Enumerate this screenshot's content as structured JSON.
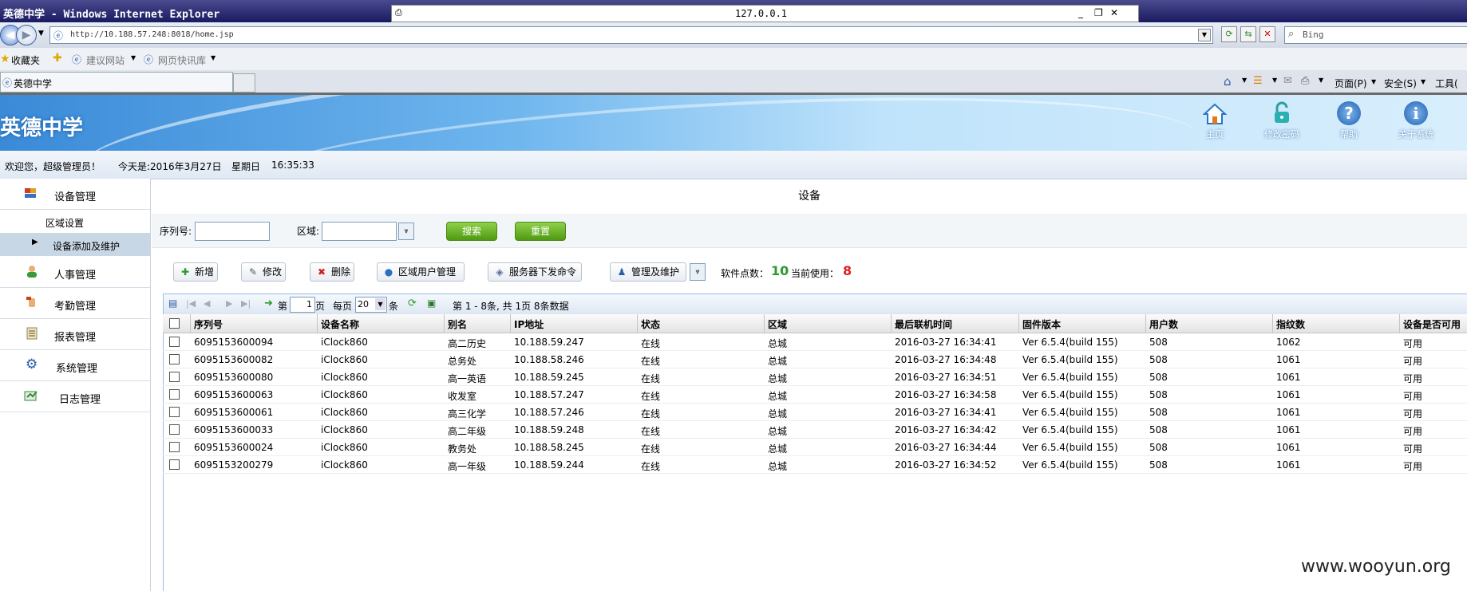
{
  "browser": {
    "window_title": "英德中学 - Windows Internet Explorer",
    "popup_address": "127.0.0.1",
    "url": "http://10.188.57.248:8018/home.jsp",
    "search_placeholder": "Bing",
    "favorites_label": "收藏夹",
    "fav_items": [
      "建议网站",
      "网页快讯库"
    ],
    "tab_title": "英德中学",
    "commands": [
      "页面(P)",
      "安全(S)",
      "工具("
    ]
  },
  "header": {
    "logo": "英德中学",
    "nav": [
      {
        "label": "主页",
        "icon": "home-icon"
      },
      {
        "label": "修改密码",
        "icon": "lock-icon"
      },
      {
        "label": "帮助",
        "icon": "help-icon"
      },
      {
        "label": "关于系统",
        "icon": "info-icon"
      }
    ]
  },
  "welcome": {
    "greeting": "欢迎您，超级管理员！",
    "today": "今天是:2016年3月27日",
    "weekday": "星期日",
    "time": "16:35:33"
  },
  "sidebar": {
    "menu": [
      {
        "label": "设备管理",
        "icon": "device-icon"
      },
      {
        "label": "人事管理",
        "icon": "person-icon"
      },
      {
        "label": "考勤管理",
        "icon": "attendance-icon"
      },
      {
        "label": "报表管理",
        "icon": "report-icon"
      },
      {
        "label": "系统管理",
        "icon": "gear-icon"
      },
      {
        "label": "日志管理",
        "icon": "log-icon"
      }
    ],
    "sub": [
      "区域设置",
      "设备添加及维护"
    ]
  },
  "content": {
    "title": "设备",
    "search": {
      "serial_label": "序列号:",
      "area_label": "区域:",
      "search_btn": "搜索",
      "reset_btn": "重置"
    },
    "toolbar": {
      "add": "新增",
      "edit": "修改",
      "delete": "删除",
      "area_user": "区域用户管理",
      "server_cmd": "服务器下发命令",
      "manage": "管理及维护",
      "points_label": "软件点数：",
      "points_value": "10",
      "in_use_label": "当前使用：",
      "in_use_value": "8"
    },
    "pager": {
      "page_prefix": "第",
      "page_value": "1",
      "page_suffix": "页",
      "per_page_label": "每页",
      "per_page_value": "20",
      "per_page_unit": "条",
      "summary": "第 1 - 8条, 共 1页 8条数据"
    },
    "columns": [
      "序列号",
      "设备名称",
      "别名",
      "IP地址",
      "状态",
      "区域",
      "最后联机时间",
      "固件版本",
      "用户数",
      "指纹数",
      "设备是否可用"
    ],
    "rows": [
      [
        "6095153600094",
        "iClock860",
        "高二历史",
        "10.188.59.247",
        "在线",
        "总城",
        "2016-03-27 16:34:41",
        "Ver 6.5.4(build 155)",
        "508",
        "1062",
        "可用"
      ],
      [
        "6095153600082",
        "iClock860",
        "总务处",
        "10.188.58.246",
        "在线",
        "总城",
        "2016-03-27 16:34:48",
        "Ver 6.5.4(build 155)",
        "508",
        "1061",
        "可用"
      ],
      [
        "6095153600080",
        "iClock860",
        "高一英语",
        "10.188.59.245",
        "在线",
        "总城",
        "2016-03-27 16:34:51",
        "Ver 6.5.4(build 155)",
        "508",
        "1061",
        "可用"
      ],
      [
        "6095153600063",
        "iClock860",
        "收发室",
        "10.188.57.247",
        "在线",
        "总城",
        "2016-03-27 16:34:58",
        "Ver 6.5.4(build 155)",
        "508",
        "1061",
        "可用"
      ],
      [
        "6095153600061",
        "iClock860",
        "高三化学",
        "10.188.57.246",
        "在线",
        "总城",
        "2016-03-27 16:34:41",
        "Ver 6.5.4(build 155)",
        "508",
        "1061",
        "可用"
      ],
      [
        "6095153600033",
        "iClock860",
        "高二年级",
        "10.188.59.248",
        "在线",
        "总城",
        "2016-03-27 16:34:42",
        "Ver 6.5.4(build 155)",
        "508",
        "1061",
        "可用"
      ],
      [
        "6095153600024",
        "iClock860",
        "教务处",
        "10.188.58.245",
        "在线",
        "总城",
        "2016-03-27 16:34:44",
        "Ver 6.5.4(build 155)",
        "508",
        "1061",
        "可用"
      ],
      [
        "6095153200279",
        "iClock860",
        "高一年级",
        "10.188.59.244",
        "在线",
        "总城",
        "2016-03-27 16:34:52",
        "Ver 6.5.4(build 155)",
        "508",
        "1061",
        "可用"
      ]
    ]
  },
  "watermark": "www.wooyun.org"
}
